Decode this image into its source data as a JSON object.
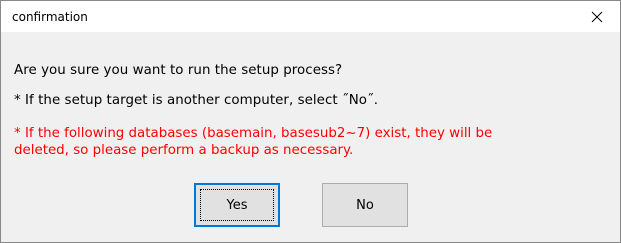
{
  "dialog": {
    "title": "confirmation",
    "close_icon": "close-icon",
    "message_line1": "Are you sure you want to run the setup process?",
    "message_line2": "* If the setup target is another computer, select ˝No˝.",
    "warning_text": "* If the following databases (basemain, basesub2~7) exist, they will be\ndeleted, so please perform a backup as necessary.",
    "warning_color": "#ff0000",
    "yes_label": "Yes",
    "no_label": "No",
    "focus_accent": "#0078d7"
  }
}
